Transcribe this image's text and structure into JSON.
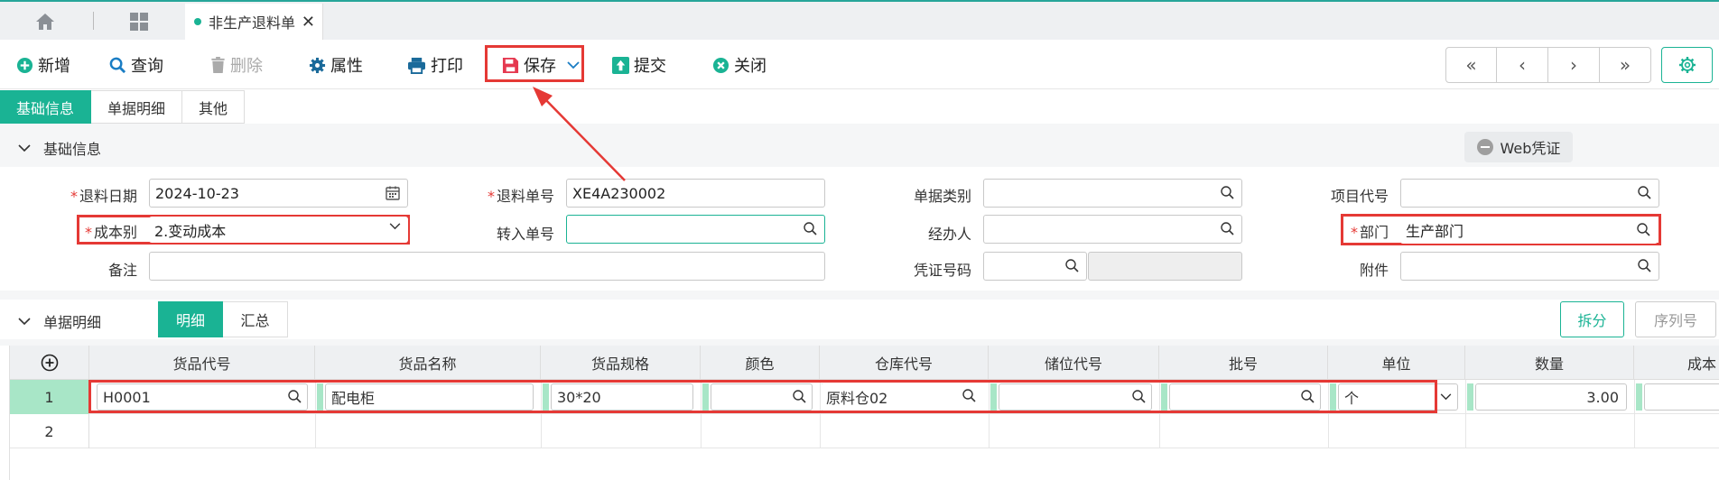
{
  "tabbar": {
    "active_tab": "非生产退料单",
    "close": "✕"
  },
  "toolbar": {
    "add": "新增",
    "query": "查询",
    "delete": "删除",
    "properties": "属性",
    "print": "打印",
    "save": "保存",
    "submit": "提交",
    "close": "关闭",
    "nav": [
      "«",
      "‹",
      "›",
      "»"
    ]
  },
  "subtabs": [
    "基础信息",
    "单据明细",
    "其他"
  ],
  "basic_section": {
    "title": "基础信息",
    "web_voucher": "Web凭证"
  },
  "form": {
    "return_date_label": "退料日期",
    "return_date_value": "2024-10-23",
    "return_no_label": "退料单号",
    "return_no_value": "XE4A230002",
    "doc_type_label": "单据类别",
    "doc_type_value": "",
    "project_code_label": "项目代号",
    "project_code_value": "",
    "cost_type_label": "成本别",
    "cost_type_value": "2.变动成本",
    "transfer_no_label": "转入单号",
    "transfer_no_value": "",
    "handler_label": "经办人",
    "handler_value": "",
    "dept_label": "部门",
    "dept_value": "生产部门",
    "remark_label": "备注",
    "remark_value": "",
    "voucher_no_label": "凭证号码",
    "voucher_no_value": "",
    "attachment_label": "附件",
    "attachment_value": ""
  },
  "detail_section": {
    "title": "单据明细",
    "tabs": [
      "明细",
      "汇总"
    ],
    "split": "拆分",
    "serial": "序列号"
  },
  "grid": {
    "add_icon": "⊕",
    "headers": [
      "货品代号",
      "货品名称",
      "货品规格",
      "颜色",
      "仓库代号",
      "储位代号",
      "批号",
      "单位",
      "数量",
      "成本"
    ],
    "rows": [
      {
        "no": "1",
        "item_code": "H0001",
        "item_name": "配电柜",
        "spec": "30*20",
        "color": "",
        "warehouse": "原料仓02",
        "location": "",
        "batch": "",
        "unit": "个",
        "qty": "3.00"
      },
      {
        "no": "2"
      }
    ]
  }
}
